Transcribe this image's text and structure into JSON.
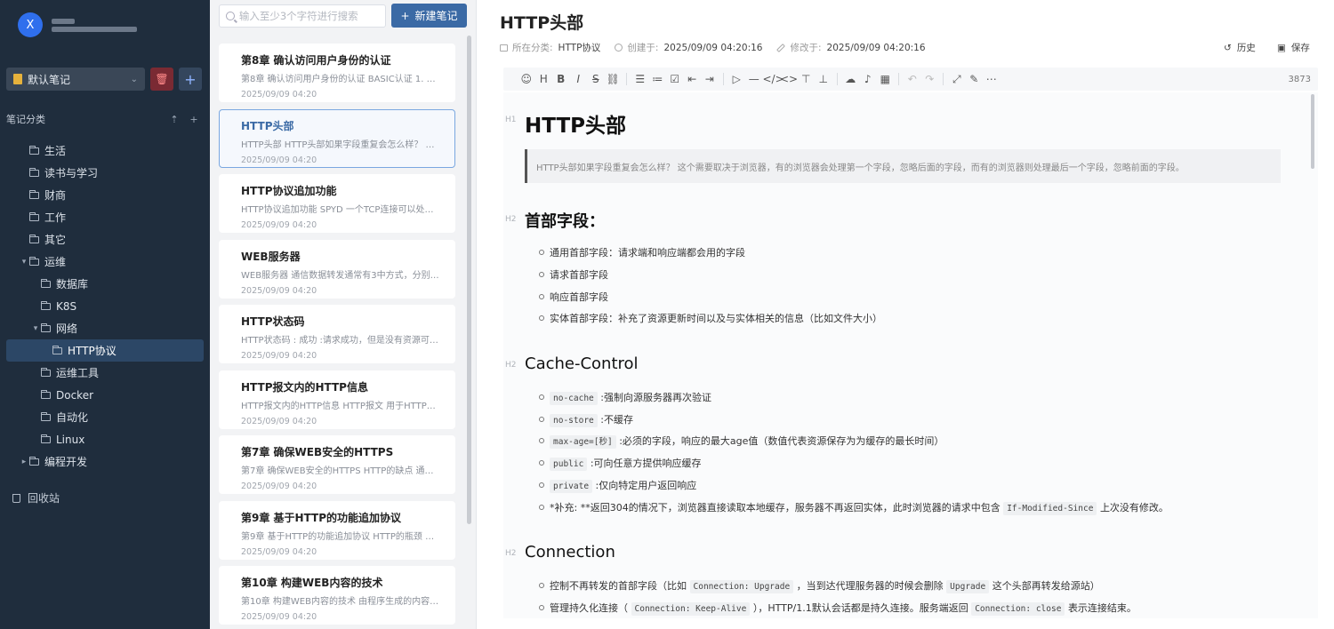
{
  "user": {
    "avatar_letter": "X"
  },
  "notebook": {
    "label": "默认笔记"
  },
  "category_header": "笔记分类",
  "tree": [
    {
      "label": "生活",
      "level": 1,
      "caret": ""
    },
    {
      "label": "读书与学习",
      "level": 1,
      "caret": ""
    },
    {
      "label": "财商",
      "level": 1,
      "caret": ""
    },
    {
      "label": "工作",
      "level": 1,
      "caret": ""
    },
    {
      "label": "其它",
      "level": 1,
      "caret": ""
    },
    {
      "label": "运维",
      "level": 1,
      "caret": "▾"
    },
    {
      "label": "数据库",
      "level": 2,
      "caret": ""
    },
    {
      "label": "K8S",
      "level": 2,
      "caret": ""
    },
    {
      "label": "网络",
      "level": 2,
      "caret": "▾"
    },
    {
      "label": "HTTP协议",
      "level": 3,
      "caret": "",
      "active": true
    },
    {
      "label": "运维工具",
      "level": 2,
      "caret": ""
    },
    {
      "label": "Docker",
      "level": 2,
      "caret": ""
    },
    {
      "label": "自动化",
      "level": 2,
      "caret": ""
    },
    {
      "label": "Linux",
      "level": 2,
      "caret": ""
    },
    {
      "label": "编程开发",
      "level": 1,
      "caret": "▸"
    }
  ],
  "trash_label": "回收站",
  "search": {
    "placeholder": "输入至少3个字符进行搜索"
  },
  "new_note_label": "新建笔记",
  "notes": [
    {
      "title": "第8章 确认访问用户身份的认证",
      "snippet": "第8章 确认访问用户身份的认证 BASIC认证 1. 服务器...",
      "date": "2025/09/09 04:20"
    },
    {
      "title": "HTTP头部",
      "snippet": "HTTP头部 HTTP头部如果字段重复会怎么样？ 这个...",
      "date": "2025/09/09 04:20",
      "selected": true
    },
    {
      "title": "HTTP协议追加功能",
      "snippet": "HTTP协议追加功能 SPYD 一个TCP连接可以处理多个...",
      "date": "2025/09/09 04:20"
    },
    {
      "title": "WEB服务器",
      "snippet": "WEB服务器 通信数据转发通常有3中方式，分别是：...",
      "date": "2025/09/09 04:20"
    },
    {
      "title": "HTTP状态码",
      "snippet": "HTTP状态码 : 成功 :请求成功，但是没有资源可返回 :...",
      "date": "2025/09/09 04:20"
    },
    {
      "title": "HTTP报文内的HTTP信息",
      "snippet": "HTTP报文内的HTTP信息 HTTP报文 用于HTTP协议...",
      "date": "2025/09/09 04:20"
    },
    {
      "title": "第7章 确保WEB安全的HTTPS",
      "snippet": "第7章 确保WEB安全的HTTPS HTTP的缺点 通信使用...",
      "date": "2025/09/09 04:20"
    },
    {
      "title": "第9章 基于HTTP的功能追加协议",
      "snippet": "第9章 基于HTTP的功能追加协议 HTTP的瓶颈 一条连...",
      "date": "2025/09/09 04:20"
    },
    {
      "title": "第10章 构建WEB内容的技术",
      "snippet": "第10章 构建WEB内容的技术 由程序生成的内容称为...",
      "date": "2025/09/09 04:20"
    }
  ],
  "doc": {
    "title": "HTTP头部",
    "meta": {
      "category_label": "所在分类:",
      "category_value": "HTTP协议",
      "created_label": "创建于:",
      "created_value": "2025/09/09 04:20:16",
      "modified_label": "修改于:",
      "modified_value": "2025/09/09 04:20:16"
    },
    "history_label": "历史",
    "save_label": "保存",
    "word_count": "3873",
    "h1": "HTTP头部",
    "blockquote": "HTTP头部如果字段重复会怎么样？ 这个需要取决于浏览器，有的浏览器会处理第一个字段，忽略后面的字段，而有的浏览器则处理最后一个字段，忽略前面的字段。",
    "sec1_title": "首部字段：",
    "sec1_items": [
      "通用首部字段：请求端和响应端都会用的字段",
      "请求首部字段",
      "响应首部字段",
      "实体首部字段：补充了资源更新时间以及与实体相关的信息（比如文件大小）"
    ],
    "sec2_title": "Cache-Control",
    "sec2_items": [
      {
        "code": "no-cache",
        "text": ":强制向源服务器再次验证"
      },
      {
        "code": "no-store",
        "text": ":不缓存"
      },
      {
        "code": "max-age=[秒]",
        "text": ":必须的字段，响应的最大age值（数值代表资源保存为为缓存的最长时间）"
      },
      {
        "code": "public",
        "text": ":可向任意方提供响应缓存"
      },
      {
        "code": "private",
        "text": ":仅向特定用户返回响应"
      }
    ],
    "sec2_extra_pre": "*补充: **返回304的情况下，浏览器直接读取本地缓存，服务器不再返回实体，此时浏览器的请求中包含",
    "sec2_extra_code": "If-Modified-Since",
    "sec2_extra_post": "上次没有修改。",
    "sec3_title": "Connection",
    "sec3_l1_pre": "控制不再转发的首部字段（比如",
    "sec3_l1_code1": "Connection: Upgrade",
    "sec3_l1_mid": "，当到达代理服务器的时候会删除",
    "sec3_l1_code2": "Upgrade",
    "sec3_l1_post": "这个头部再转发给源站）",
    "sec3_l2_pre": "管理持久化连接（",
    "sec3_l2_code1": "Connection: Keep-Alive",
    "sec3_l2_mid": "），HTTP/1.1默认会话都是持久连接。服务端返回",
    "sec3_l2_code2": "Connection: close",
    "sec3_l2_post": "表示连接结束。"
  },
  "colors": {
    "sidebar_bg": "#1f2d3d",
    "accent": "#3b6aa5",
    "active_tree": "#2c4766"
  },
  "icons": [
    "search-icon",
    "plus-icon",
    "trash-icon",
    "folder-icon",
    "history-icon",
    "save-icon"
  ]
}
